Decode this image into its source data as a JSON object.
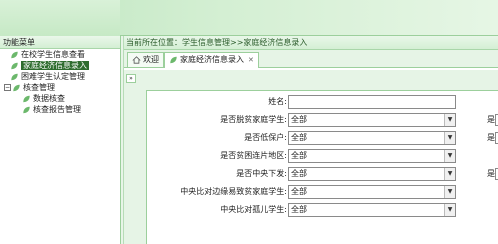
{
  "sidebar": {
    "title": "功能菜单",
    "items": [
      {
        "label": "在校学生信息查看",
        "level": 1,
        "selected": false
      },
      {
        "label": "家庭经济信息录入",
        "level": 1,
        "selected": true
      },
      {
        "label": "困难学生认定管理",
        "level": 1,
        "selected": false
      },
      {
        "label": "核查管理",
        "level": 0,
        "expander": "−",
        "selected": false
      },
      {
        "label": "数据核查",
        "level": 2,
        "selected": false
      },
      {
        "label": "核查报告管理",
        "level": 2,
        "selected": false
      }
    ]
  },
  "breadcrumb": "当前所在位置：学生信息管理>>家庭经济信息录入",
  "tabs": [
    {
      "label": "欢迎",
      "active": false
    },
    {
      "label": "家庭经济信息录入",
      "active": true,
      "close": "✕"
    }
  ],
  "collapse_glyph": "»",
  "form": {
    "rows": [
      {
        "label": "姓名:",
        "type": "text",
        "value": ""
      },
      {
        "label": "是否脱贫家庭学生:",
        "type": "select",
        "value": "全部",
        "right_label": "是"
      },
      {
        "label": "是否低保户:",
        "type": "select",
        "value": "全部",
        "right_label": "是"
      },
      {
        "label": "是否贫困连片地区:",
        "type": "select",
        "value": "全部",
        "right_label": ""
      },
      {
        "label": "是否中央下发:",
        "type": "select",
        "value": "全部",
        "right_label": "是"
      },
      {
        "label": "中央比对边缘易致贫家庭学生:",
        "type": "select",
        "value": "全部",
        "right_label": ""
      },
      {
        "label": "中央比对孤儿学生:",
        "type": "select",
        "value": "全部",
        "right_label": ""
      }
    ],
    "select_arrow": "▼"
  },
  "colors": {
    "accent": "#2e6c2e",
    "banner": "#c6e9c5",
    "border": "#9ccf9c",
    "leaf": "#6cb86c"
  },
  "icons": {
    "menu_item": "leaf-icon",
    "tab_welcome": "home-icon",
    "tab_active": "leaf-icon"
  }
}
